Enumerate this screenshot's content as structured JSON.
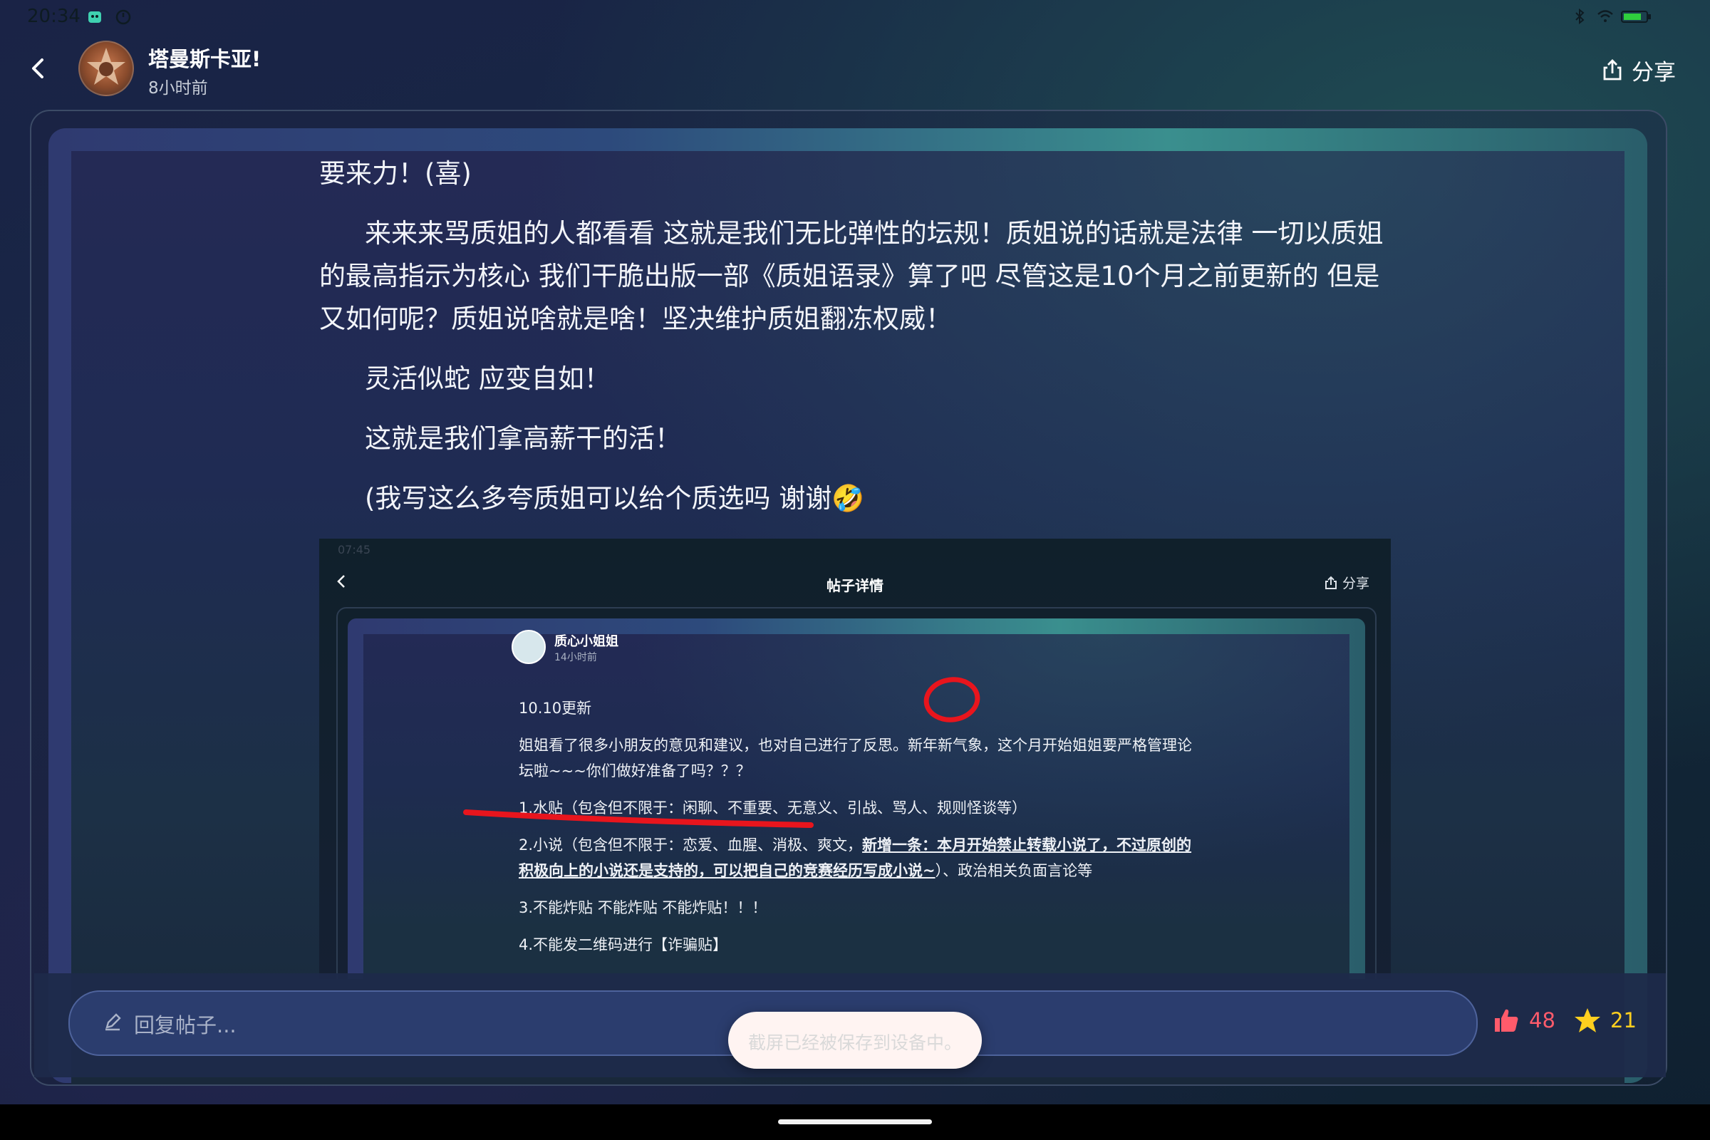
{
  "status_bar": {
    "time": "20:34"
  },
  "header": {
    "username": "塔曼斯卡亚!",
    "post_time": "8小时前",
    "share_label": "分享"
  },
  "post": {
    "paragraphs": [
      "要来力！(喜)",
      "来来来骂质姐的人都看看 这就是我们无比弹性的坛规！质姐说的话就是法律 一切以质姐的最高指示为核心 我们干脆出版一部《质姐语录》算了吧 尽管这是10个月之前更新的 但是又如何呢？质姐说啥就是啥！坚决维护质姐翻冻权威！",
      "灵活似蛇 应变自如！",
      "这就是我们拿高薪干的活！",
      "(我写这么多夸质姐可以给个质选吗 谢谢🤣"
    ]
  },
  "embedded_screenshot": {
    "status_time": "07:45",
    "title": "帖子详情",
    "share_label": "分享",
    "username": "质心小姐姐",
    "post_time": "14小时前",
    "update_line": "10.10更新",
    "intro": "姐姐看了很多小朋友的意见和建议，也对自己进行了反思。新年新气象，这个月开始姐姐要严格管理论坛啦~~~你们做好准备了吗？？？",
    "rule_1": "1.水贴（包含但不限于：闲聊、不重要、无意义、引战、骂人、规则怪谈等）",
    "rule_2_start": "2.小说（包含但不限于：恋爱、血腥、消极、爽文，",
    "rule_2_bold": "新增一条：本月开始禁止转载小说了，不过原创的积极向上的小说还是支持的，可以把自己的竞赛经历写成小说~",
    "rule_2_end": "）、政治相关负面言论等",
    "rule_3": "3.不能炸贴 不能炸贴 不能炸贴！！！",
    "rule_4": "4.不能发二维码进行【诈骗贴】"
  },
  "reply": {
    "placeholder": "回复帖子...",
    "likes": "48",
    "stars": "21"
  },
  "toast": "截屏已经被保存到设备中。",
  "colors": {
    "like": "#ff5b6b",
    "star": "#ffcf1f",
    "annotation": "#e8151d"
  }
}
